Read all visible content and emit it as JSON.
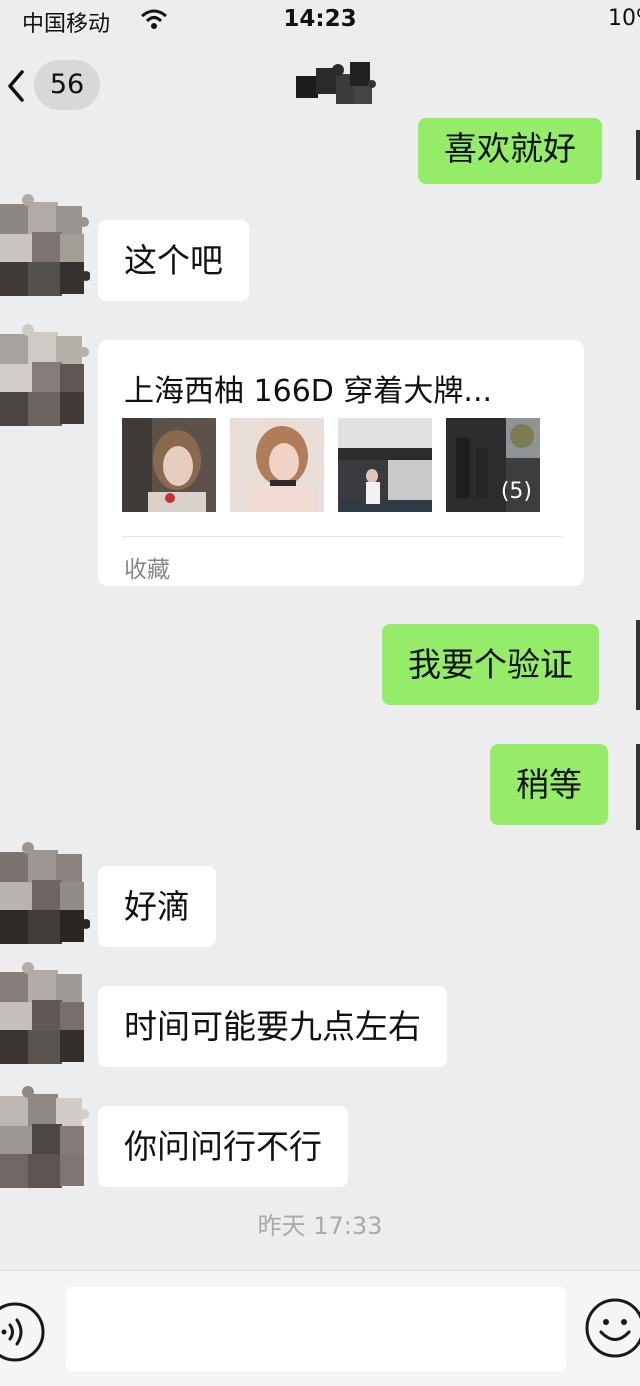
{
  "status_bar": {
    "carrier": "中国移动",
    "time": "14:23",
    "battery": "10%"
  },
  "nav": {
    "unread_count": "56"
  },
  "messages": {
    "m0": "喜欢就好",
    "m1": "这个吧",
    "m3": "我要个验证",
    "m4": "稍等",
    "m5": "好滴",
    "m6": "时间可能要九点左右",
    "m7": "你问问行不行"
  },
  "card": {
    "title": "上海西柚 166D 穿着大牌...",
    "image_count": "(5)",
    "source": "收藏"
  },
  "timestamp": "昨天 17:33",
  "input": {
    "placeholder": ""
  },
  "colors": {
    "background": "#ededed",
    "outgoing_bubble": "#95ec69",
    "incoming_bubble": "#ffffff"
  },
  "icons": [
    "wifi-icon",
    "back-chevron-icon",
    "voice-icon",
    "emoji-icon"
  ]
}
